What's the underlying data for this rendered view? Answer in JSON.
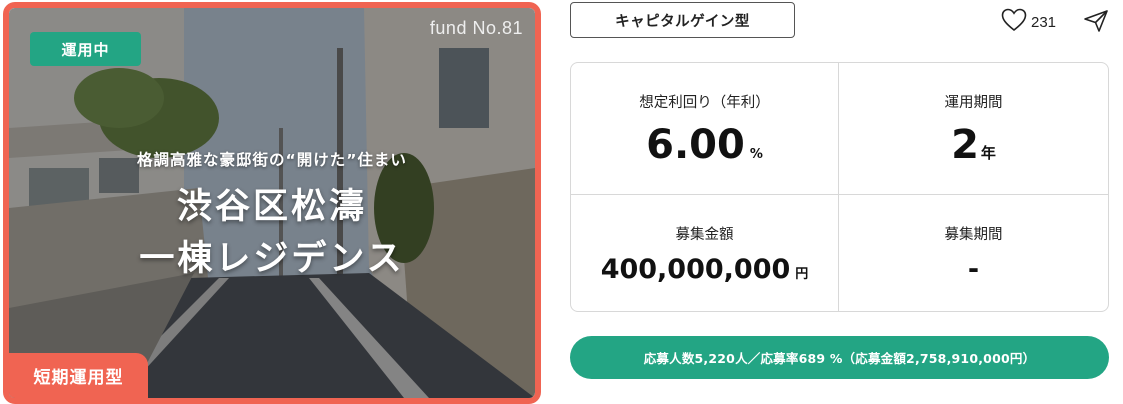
{
  "card": {
    "fund_no": "fund No.81",
    "status": "運用中",
    "catchphrase": "格調高雅な豪邸街の“開けた”住まい",
    "title_line1": "渋谷区松濤",
    "title_line2": "一棟レジデンス",
    "term_badge": "短期運用型"
  },
  "header": {
    "type_tag": "キャピタルゲイン型",
    "like_count": "231",
    "like_icon": "heart-icon",
    "share_icon": "send-icon"
  },
  "stats": {
    "yield_label": "想定利回り（年利）",
    "yield_value": "6.00",
    "yield_unit": "%",
    "period_label": "運用期間",
    "period_value": "2",
    "period_unit": "年",
    "amount_label": "募集金額",
    "amount_value": "400,000,000",
    "amount_unit": "円",
    "recruit_label": "募集期間",
    "recruit_value": "-"
  },
  "apply_bar": {
    "text": "応募人数5,220人／応募率689 %（応募金額2,758,910,000円）"
  },
  "colors": {
    "accent_green": "#23a584",
    "accent_coral": "#f06452"
  }
}
